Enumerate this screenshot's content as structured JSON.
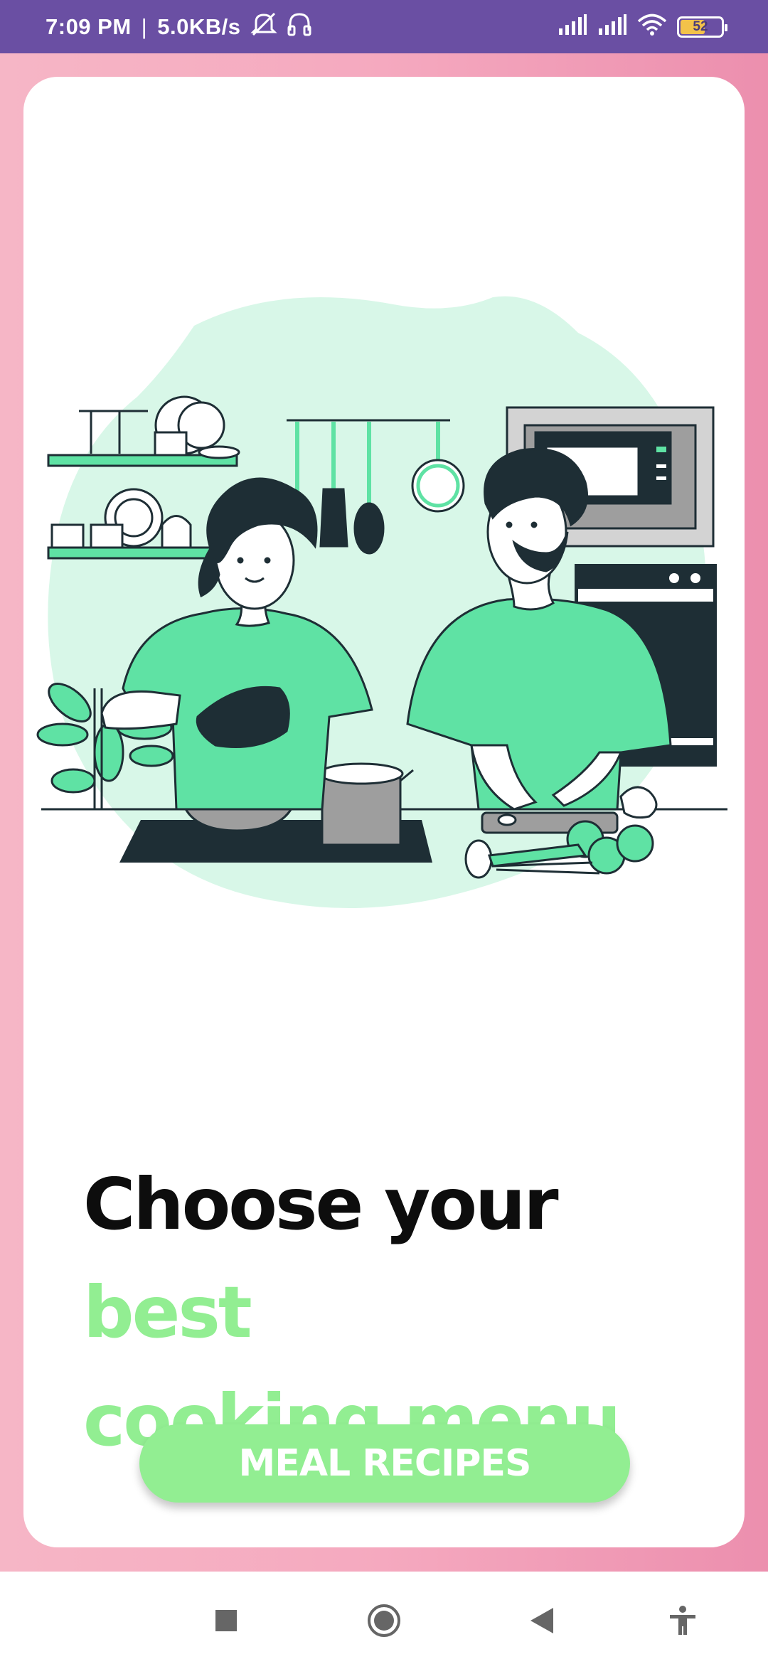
{
  "status_bar": {
    "time": "7:09 PM",
    "network_speed": "5.0KB/s",
    "battery_level": "52",
    "icons": [
      "mute-icon",
      "headset-icon",
      "signal-icon",
      "signal-icon",
      "wifi-icon",
      "battery-icon"
    ]
  },
  "onboarding": {
    "headline_part1": "Choose your ",
    "headline_accent1": "best",
    "headline_accent2": "cooking menu",
    "cta_label": "MEAL RECIPES"
  },
  "colors": {
    "status_bar": "#6a4fa3",
    "accent_green": "#92ee92",
    "illustration_green": "#5fe2a4",
    "illustration_dark": "#1e2e35",
    "blob": "#d8f7e8"
  },
  "nav_bar": {
    "buttons": [
      "recents-square-icon",
      "home-circle-icon",
      "back-triangle-icon",
      "accessibility-icon"
    ]
  }
}
